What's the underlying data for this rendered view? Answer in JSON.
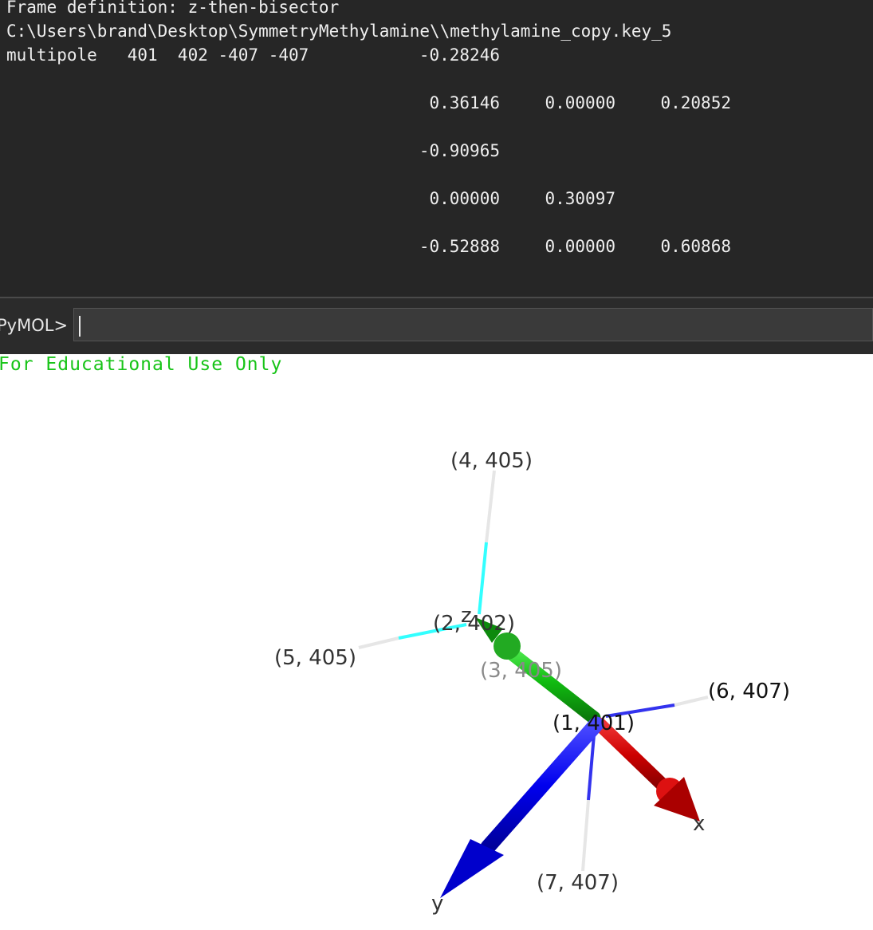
{
  "console": {
    "frame_definition": "Frame definition: z-then-bisector",
    "file_path": "C:\\Users\\brand\\Desktop\\SymmetryMethylamine\\\\methylamine_copy.key_5",
    "multipole_line": "multipole   401  402 -407 -407",
    "rows": [
      [
        "-0.28246"
      ],
      [
        "0.36146",
        "0.00000",
        "0.20852"
      ],
      [
        "-0.90965"
      ],
      [
        "0.00000",
        "0.30097"
      ],
      [
        "-0.52888",
        "0.00000",
        "0.60868"
      ]
    ]
  },
  "command_bar": {
    "prompt": "PyMOL>",
    "value": ""
  },
  "viewer": {
    "watermark": "For Educational Use Only",
    "atom_labels": {
      "a1": "(1, 401)",
      "a2": "(2, 402)",
      "a3": "(3, 405)",
      "a4": "(4, 405)",
      "a5": "(5, 405)",
      "a6": "(6, 407)",
      "a7": "(7, 407)"
    },
    "axis_labels": {
      "x": "x",
      "y": "y",
      "z": "z"
    },
    "colors": {
      "x_axis": "#cc0000",
      "y_axis": "#0000ee",
      "z_axis": "#11bb11",
      "carbon_bond": "#33ffff",
      "nitrogen_bond": "#3333ee",
      "hydrogen_bond": "#e6e6e6",
      "watermark": "#18c418",
      "console_bg": "#262626"
    }
  }
}
